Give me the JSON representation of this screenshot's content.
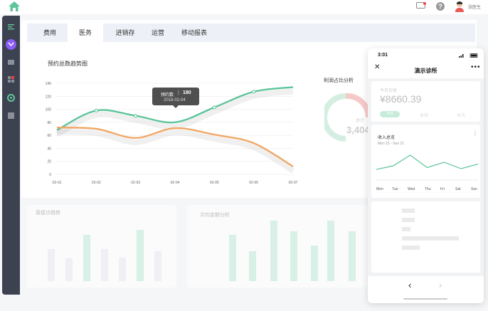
{
  "header": {
    "username": "张医生"
  },
  "tabs": [
    {
      "label": "费用"
    },
    {
      "label": "医务"
    },
    {
      "label": "进销存"
    },
    {
      "label": "运营"
    },
    {
      "label": "移动报表"
    }
  ],
  "active_tab": "医务",
  "trend_chart": {
    "title": "预约总数趋势图"
  },
  "tooltip": {
    "label": "预约数",
    "value": "180",
    "date": "2018-02-04"
  },
  "donut": {
    "title": "利润占比分析",
    "label": "总计",
    "value": "3,404"
  },
  "bottom_left": {
    "title": "周接诊趋势"
  },
  "bottom_mid": {
    "title": "次均金额分析"
  },
  "phone": {
    "time": "3:01",
    "title": "演示诊所",
    "today_label": "今日实收",
    "amount": "¥8660.39",
    "seg_today": "今日",
    "seg_week": "本周",
    "seg_month": "本月",
    "revenue_title": "收入总览",
    "revenue_range": "Mon 15 - Sun 21",
    "days": [
      "Mon",
      "Tue",
      "Wed",
      "Thu",
      "Fri",
      "Sat",
      "Sun"
    ]
  },
  "colors": {
    "accent_green": "#5ec49a",
    "accent_orange": "#f0a868",
    "sidebar": "#3d4250",
    "active_icon": "#8b5cf6"
  },
  "chart_data": [
    {
      "type": "line",
      "title": "预约总数趋势图",
      "x": [
        "02-01",
        "02-02",
        "02-03",
        "02-04",
        "02-05",
        "02-06",
        "02-07"
      ],
      "yticks": [
        0,
        20,
        40,
        60,
        80,
        100,
        120,
        140
      ],
      "ylim": [
        0,
        140
      ],
      "series": [
        {
          "name": "",
          "color": "#5ec49a",
          "values": [
            68,
            98,
            90,
            80,
            103,
            127,
            134
          ]
        },
        {
          "name": "",
          "color": "#f0a868",
          "values": [
            72,
            70,
            56,
            71,
            61,
            48,
            12
          ]
        }
      ]
    },
    {
      "type": "line",
      "title": "收入总览",
      "x": [
        "Mon",
        "Tue",
        "Wed",
        "Thu",
        "Fri",
        "Sat",
        "Sun"
      ],
      "series": [
        {
          "name": "",
          "color": "#5ec49a",
          "values": [
            20,
            30,
            60,
            25,
            40,
            22,
            35
          ]
        }
      ]
    }
  ]
}
